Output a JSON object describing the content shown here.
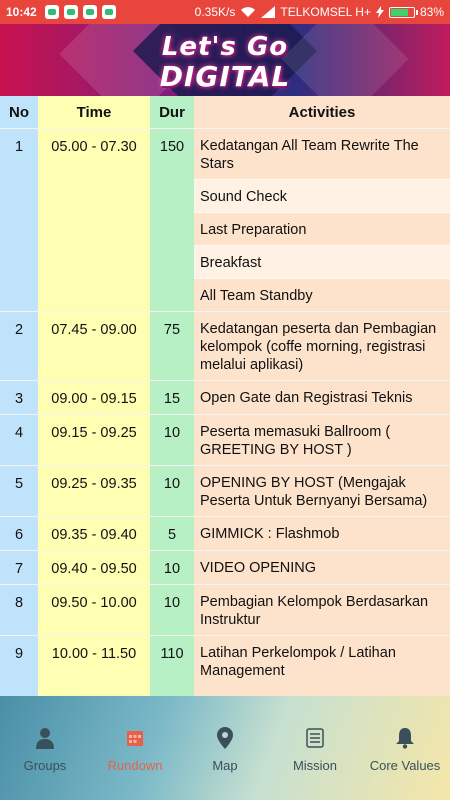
{
  "status_bar": {
    "time": "10:42",
    "speed": "0.35K/s",
    "carrier": "TELKOMSEL H+",
    "battery": "83%",
    "battery_level": 0.83
  },
  "banner": {
    "line1": "Let's Go",
    "line2": "DIGITAL"
  },
  "table": {
    "headers": {
      "no": "No",
      "time": "Time",
      "dur": "Dur",
      "activities": "Activities"
    },
    "rows": [
      {
        "no": "1",
        "time": "05.00 - 07.30",
        "dur": "150",
        "activities": [
          "Kedatangan All Team Rewrite The Stars",
          "Sound Check",
          "Last Preparation",
          "Breakfast",
          "All Team Standby"
        ]
      },
      {
        "no": "2",
        "time": "07.45 - 09.00",
        "dur": "75",
        "activities": [
          "Kedatangan peserta dan Pembagian kelompok (coffe morning, registrasi melalui aplikasi)"
        ]
      },
      {
        "no": "3",
        "time": "09.00 - 09.15",
        "dur": "15",
        "activities": [
          "Open Gate dan Registrasi Teknis"
        ]
      },
      {
        "no": "4",
        "time": "09.15 - 09.25",
        "dur": "10",
        "activities": [
          "Peserta memasuki Ballroom ( GREETING BY HOST )"
        ]
      },
      {
        "no": "5",
        "time": "09.25 - 09.35",
        "dur": "10",
        "activities": [
          "OPENING BY HOST (Mengajak Peserta Untuk Bernyanyi Bersama)"
        ]
      },
      {
        "no": "6",
        "time": "09.35 - 09.40",
        "dur": "5",
        "activities": [
          "GIMMICK : Flashmob"
        ]
      },
      {
        "no": "7",
        "time": "09.40 - 09.50",
        "dur": "10",
        "activities": [
          "VIDEO OPENING"
        ]
      },
      {
        "no": "8",
        "time": "09.50 - 10.00",
        "dur": "10",
        "activities": [
          "Pembagian Kelompok Berdasarkan Instruktur"
        ]
      },
      {
        "no": "9",
        "time": "10.00 - 11.50",
        "dur": "110",
        "activities": [
          "Latihan Perkelompok / Latihan Management"
        ]
      }
    ]
  },
  "bottom_nav": {
    "items": [
      {
        "label": "Groups",
        "icon": "person-icon"
      },
      {
        "label": "Rundown",
        "icon": "calendar-icon"
      },
      {
        "label": "Map",
        "icon": "map-pin-icon"
      },
      {
        "label": "Mission",
        "icon": "checklist-icon"
      },
      {
        "label": "Core Values",
        "icon": "bell-icon"
      }
    ],
    "active_color": "#e8604a"
  }
}
